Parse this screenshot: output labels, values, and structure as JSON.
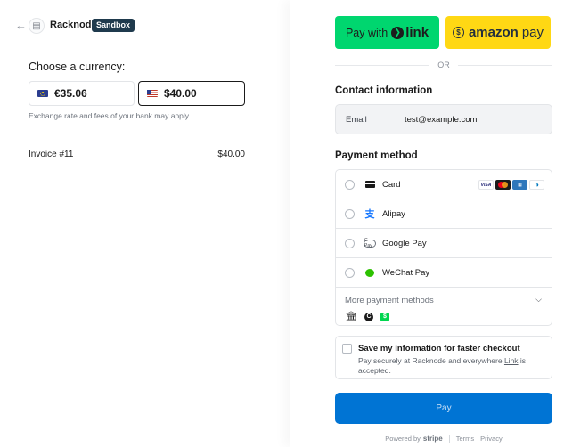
{
  "header": {
    "back_icon": "arrow-left-icon",
    "merchant_name": "Racknode",
    "sandbox_badge": "Sandbox"
  },
  "currency": {
    "heading": "Choose a currency:",
    "options": [
      {
        "flag": "eu-flag",
        "amount": "€35.06",
        "selected": false
      },
      {
        "flag": "us-flag",
        "amount": "$40.00",
        "selected": true
      }
    ],
    "note": "Exchange rate and fees of your bank may apply"
  },
  "invoice": {
    "label": "Invoice #11",
    "amount": "$40.00"
  },
  "express": {
    "link_prefix": "Pay with",
    "link_word": "link",
    "amazon_word": "amazon",
    "amazon_suffix": "pay",
    "separator": "OR"
  },
  "contact": {
    "heading": "Contact information",
    "email_label": "Email",
    "email_value": "test@example.com"
  },
  "payment": {
    "heading": "Payment method",
    "methods": [
      {
        "label": "Card",
        "icon": "card-icon"
      },
      {
        "label": "Alipay",
        "icon": "alipay-icon"
      },
      {
        "label": "Google Pay",
        "icon": "google-pay-icon"
      },
      {
        "label": "WeChat Pay",
        "icon": "wechat-icon"
      }
    ],
    "card_brands": [
      "VISA",
      "mastercard",
      "amex",
      "diners"
    ],
    "more_label": "More payment methods",
    "more_icons": [
      "bank-icon",
      "c-icon",
      "cash-app-icon"
    ]
  },
  "save": {
    "title": "Save my information for faster checkout",
    "desc_before": "Pay securely at Racknode and everywhere ",
    "desc_link": "Link",
    "desc_after": " is accepted."
  },
  "pay_button": "Pay",
  "footer": {
    "powered": "Powered by",
    "brand": "stripe",
    "terms": "Terms",
    "privacy": "Privacy"
  },
  "colors": {
    "link_green": "#00d66f",
    "amazon_yellow": "#ffd814",
    "pay_blue": "#0074d4",
    "sandbox_badge": "#1f3a4d"
  }
}
